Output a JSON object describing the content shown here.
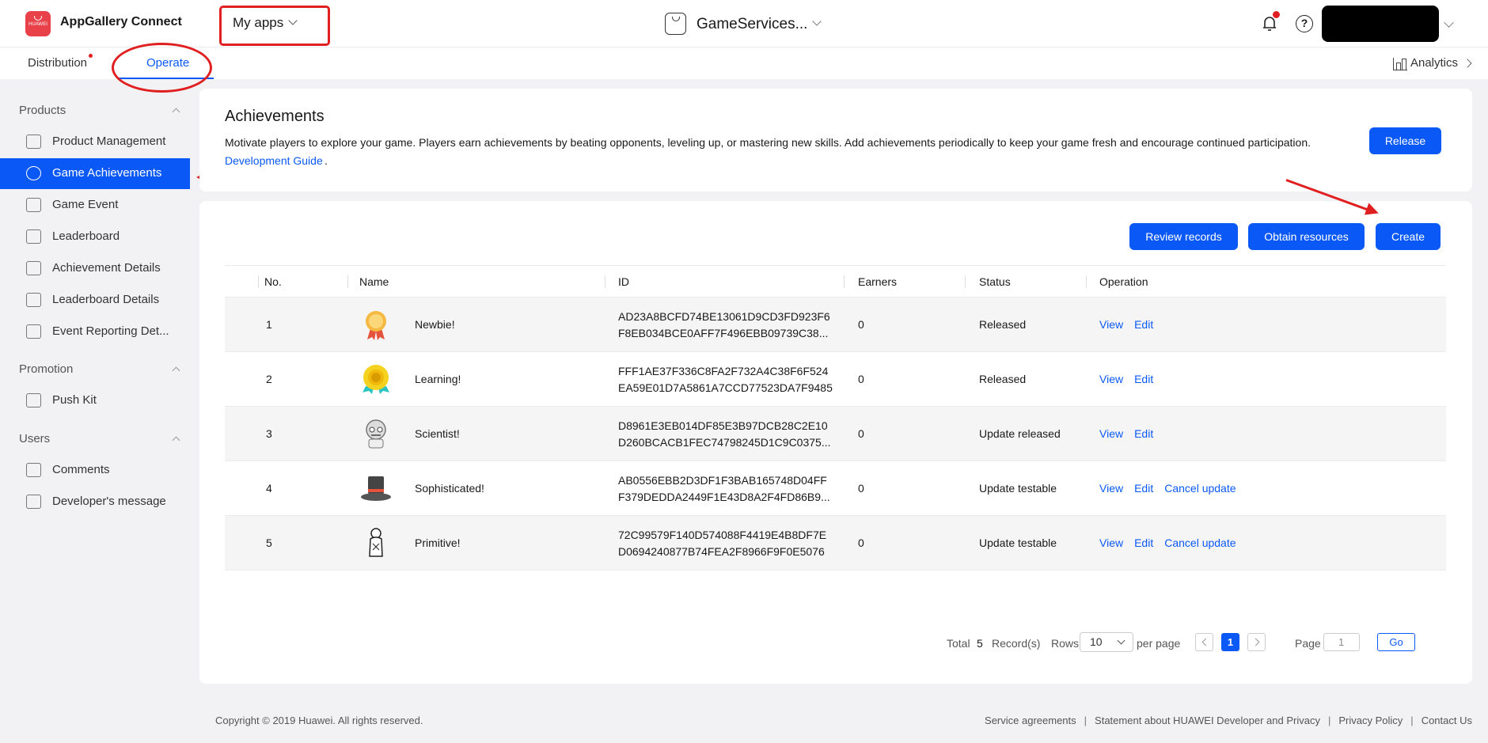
{
  "header": {
    "logo_text": "HUAWEI",
    "brand": "AppGallery Connect",
    "my_apps": "My apps",
    "app_name": "GameServices..."
  },
  "tabs": {
    "distribution": "Distribution",
    "operate": "Operate",
    "analytics": "Analytics"
  },
  "sidebar": {
    "products_heading": "Products",
    "promotion_heading": "Promotion",
    "users_heading": "Users",
    "items": [
      {
        "label": "Product Management",
        "icon": "bag-icon"
      },
      {
        "label": "Game Achievements",
        "icon": "achievement-icon"
      },
      {
        "label": "Game Event",
        "icon": "event-icon"
      },
      {
        "label": "Leaderboard",
        "icon": "leaderboard-icon"
      },
      {
        "label": "Achievement Details",
        "icon": "achievement-details-icon"
      },
      {
        "label": "Leaderboard Details",
        "icon": "leaderboard-details-icon"
      },
      {
        "label": "Event Reporting Det...",
        "icon": "event-report-icon"
      },
      {
        "label": "Push Kit",
        "icon": "rocket-icon"
      },
      {
        "label": "Comments",
        "icon": "comments-icon"
      },
      {
        "label": "Developer's message",
        "icon": "message-icon"
      }
    ]
  },
  "achievements": {
    "title": "Achievements",
    "description": "Motivate players to explore your game. Players earn achievements by beating opponents, leveling up, or mastering new skills. Add achievements periodically to keep your game fresh and encourage continued participation.",
    "guide_link": "Development Guide",
    "guide_suffix": ".",
    "release_button": "Release"
  },
  "toolbar": {
    "review": "Review records",
    "obtain": "Obtain resources",
    "create": "Create"
  },
  "table": {
    "columns": [
      "No.",
      "Name",
      "ID",
      "Earners",
      "Status",
      "Operation"
    ],
    "rows": [
      {
        "no": "1",
        "name": "Newbie!",
        "id1": "AD23A8BCFD74BE13061D9CD3FD923F6",
        "id2": "F8EB034BCE0AFF7F496EBB09739C38...",
        "earners": "0",
        "status": "Released",
        "ops": [
          "View",
          "Edit"
        ]
      },
      {
        "no": "2",
        "name": "Learning!",
        "id1": "FFF1AE37F336C8FA2F732A4C38F6F524",
        "id2": "EA59E01D7A5861A7CCD77523DA7F9485",
        "earners": "0",
        "status": "Released",
        "ops": [
          "View",
          "Edit"
        ]
      },
      {
        "no": "3",
        "name": "Scientist!",
        "id1": "D8961E3EB014DF85E3B97DCB28C2E10",
        "id2": "D260BCACB1FEC74798245D1C9C0375...",
        "earners": "0",
        "status": "Update released",
        "ops": [
          "View",
          "Edit"
        ]
      },
      {
        "no": "4",
        "name": "Sophisticated!",
        "id1": "AB0556EBB2D3DF1F3BAB165748D04FF",
        "id2": "F379DEDDA2449F1E43D8A2F4FD86B9...",
        "earners": "0",
        "status": "Update testable",
        "ops": [
          "View",
          "Edit",
          "Cancel update"
        ]
      },
      {
        "no": "5",
        "name": "Primitive!",
        "id1": "72C99579F140D574088F4419E4B8DF7E",
        "id2": "D0694240877B74FEA2F8966F9F0E5076",
        "earners": "0",
        "status": "Update testable",
        "ops": [
          "View",
          "Edit",
          "Cancel update"
        ]
      }
    ]
  },
  "pagination": {
    "total_label": "Total",
    "total": "5",
    "records_label": "Record(s)",
    "rows_label": "Rows",
    "rows_value": "10",
    "per_page": "per page",
    "current_page": "1",
    "page_label": "Page",
    "page_input": "1",
    "go": "Go"
  },
  "footer": {
    "copyright": "Copyright © 2019 Huawei. All rights reserved.",
    "links": [
      "Service agreements",
      "Statement about HUAWEI Developer and Privacy",
      "Privacy Policy",
      "Contact Us"
    ]
  },
  "colors": {
    "accent": "#0a59f7",
    "annotation": "#e02020",
    "brand_red": "#e8414a"
  }
}
